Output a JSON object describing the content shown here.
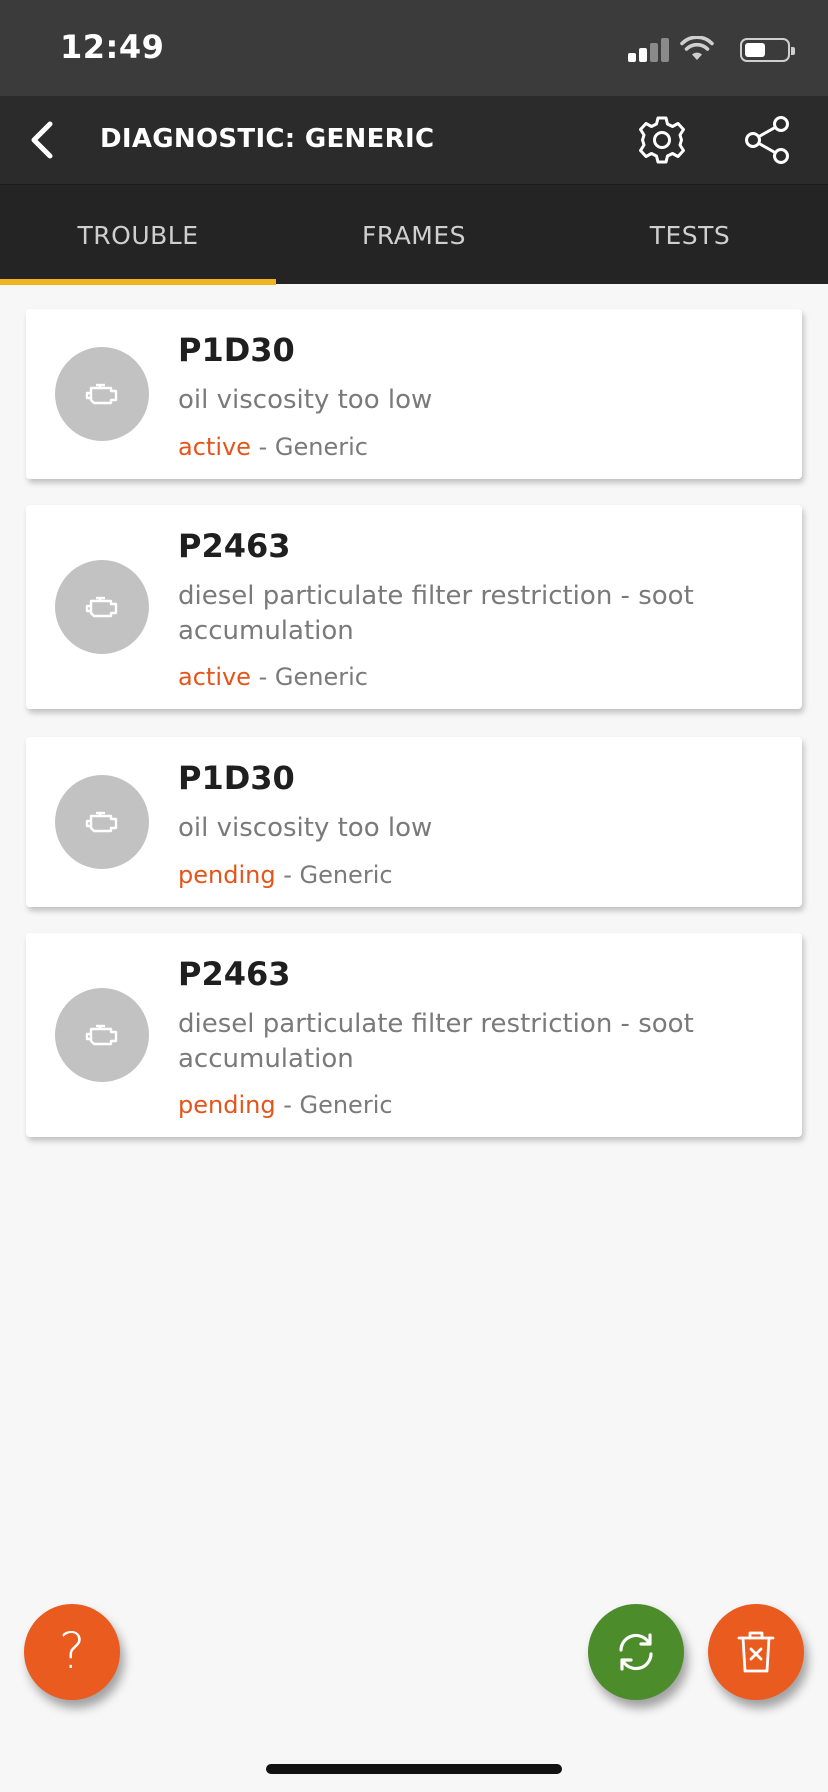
{
  "status_bar": {
    "time": "12:49",
    "icons": [
      "cellular-signal-icon",
      "wifi-icon",
      "battery-icon"
    ]
  },
  "app_bar": {
    "title": "DIAGNOSTIC: GENERIC",
    "icons": [
      "back-chevron-icon",
      "gear-icon",
      "share-icon"
    ]
  },
  "tabs": [
    {
      "label": "TROUBLE",
      "active": true
    },
    {
      "label": "FRAMES",
      "active": false
    },
    {
      "label": "TESTS",
      "active": false
    }
  ],
  "trouble_codes": [
    {
      "code": "P1D30",
      "description": "oil viscosity too low",
      "state": "active",
      "source": " - Generic",
      "icon": "engine-icon"
    },
    {
      "code": "P2463",
      "description": "diesel particulate filter restriction - soot accumulation",
      "state": "active",
      "source": " - Generic",
      "icon": "engine-icon"
    },
    {
      "code": "P1D30",
      "description": "oil viscosity too low",
      "state": "pending",
      "source": " - Generic",
      "icon": "engine-icon"
    },
    {
      "code": "P2463",
      "description": "diesel particulate filter restriction - soot accumulation",
      "state": "pending",
      "source": " - Generic",
      "icon": "engine-icon"
    }
  ],
  "fabs": {
    "help_glyph": "?",
    "icons": [
      "help-icon",
      "refresh-icon",
      "trash-icon"
    ]
  },
  "colors": {
    "status_bar_bg": "#3b3b3b",
    "app_bar_bg": "#2b2b2b",
    "tab_bar_bg": "#242424",
    "tab_indicator": "#f0b51e",
    "state_text": "#e4551b",
    "help_button": "#ea5b1f",
    "refresh_button": "#4c8c2a",
    "delete_button": "#ea5b1f",
    "icon_circle": "#c2c2c2"
  }
}
